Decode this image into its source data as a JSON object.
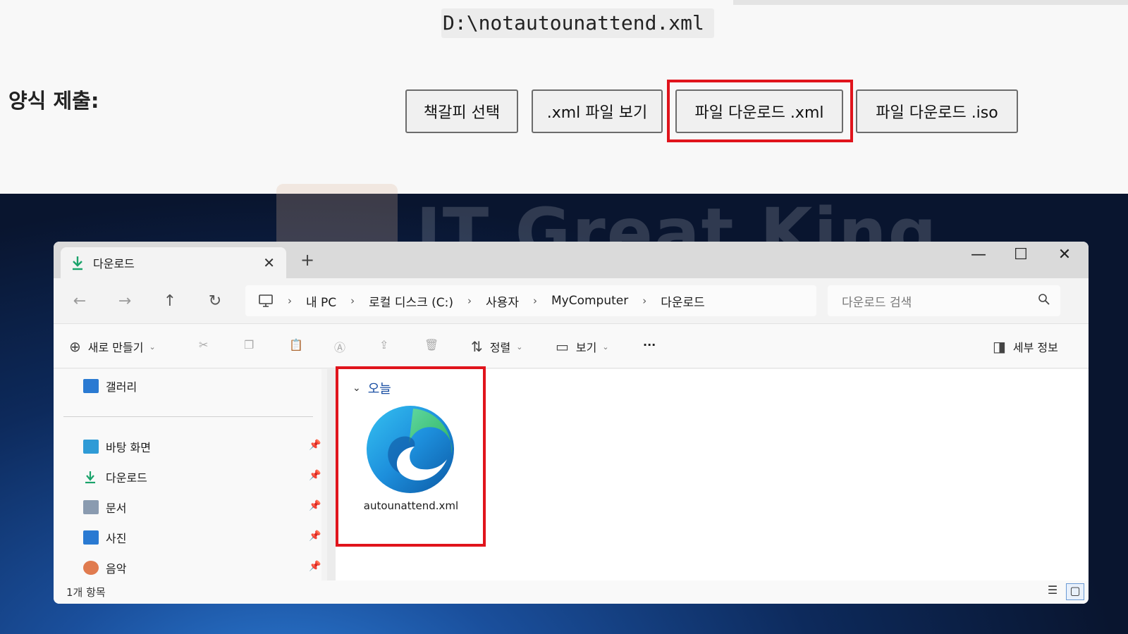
{
  "form": {
    "path": "D:\\notautounattend.xml",
    "label": "양식 제출:",
    "buttons": [
      "책갈피 선택",
      ".xml 파일 보기",
      "파일 다운로드 .xml",
      "파일 다운로드 .iso"
    ]
  },
  "watermark": "IT Great King",
  "explorer": {
    "tab_title": "다운로드",
    "tab_close": "✕",
    "new_tab": "+",
    "window_controls": {
      "minimize": "—",
      "maximize": "☐",
      "close": "✕"
    },
    "nav": {
      "back": "←",
      "forward": "→",
      "up": "↑",
      "refresh": "↻"
    },
    "breadcrumbs": [
      "내 PC",
      "로컬 디스크 (C:)",
      "사용자",
      "MyComputer",
      "다운로드"
    ],
    "breadcrumb_separator": "›",
    "search_placeholder": "다운로드 검색",
    "toolbar": {
      "new_label": "새로 만들기",
      "sort_label": "정렬",
      "view_label": "보기",
      "more_label": "···",
      "details_label": "세부 정보"
    },
    "sidebar": {
      "gallery": "갤러리",
      "quick_access": [
        {
          "label": "바탕 화면",
          "icon": "desktop-icon",
          "color": "#2f9bd6"
        },
        {
          "label": "다운로드",
          "icon": "download-icon",
          "color": "#1aa36b"
        },
        {
          "label": "문서",
          "icon": "document-icon",
          "color": "#8a9bb0"
        },
        {
          "label": "사진",
          "icon": "pictures-icon",
          "color": "#2a7ad2"
        },
        {
          "label": "음악",
          "icon": "music-icon",
          "color": "#e07b4f"
        }
      ]
    },
    "group_header": "오늘",
    "file": {
      "name": "autounattend.xml",
      "icon": "edge-icon"
    },
    "status": "1개 항목"
  },
  "colors": {
    "highlight": "#e0141c",
    "accent": "#1a4fa3"
  }
}
